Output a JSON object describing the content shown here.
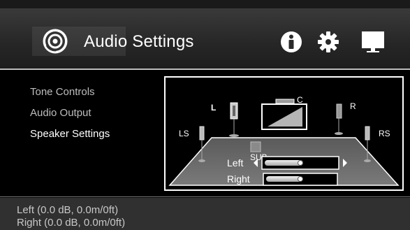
{
  "header": {
    "title": "Audio Settings",
    "app_icon": "speaker-disc-icon",
    "info_icon": "info-icon",
    "settings_icon": "gear-icon",
    "display_icon": "monitor-icon"
  },
  "menu": {
    "items": [
      {
        "label": "Tone Controls",
        "selected": false
      },
      {
        "label": "Audio Output",
        "selected": false
      },
      {
        "label": "Speaker Settings",
        "selected": true
      }
    ]
  },
  "speaker_panel": {
    "speakers": {
      "left": "L",
      "center": "C",
      "right": "R",
      "left_surround": "LS",
      "right_surround": "RS",
      "subwoofer": "SUB"
    },
    "controls": [
      {
        "label": "Left",
        "level": 0.5,
        "selected": true
      },
      {
        "label": "Right",
        "level": 0.5,
        "selected": false
      }
    ]
  },
  "status": {
    "line1": "Left (0.0 dB, 0.0m/0ft)",
    "line2": "Right (0.0 dB, 0.0m/0ft)"
  },
  "colors": {
    "background": "#000000",
    "header": "#2a2a2a",
    "floor": "#6d6d6d",
    "selected_text": "#ffffff",
    "menu_text": "#bdbdbd"
  }
}
